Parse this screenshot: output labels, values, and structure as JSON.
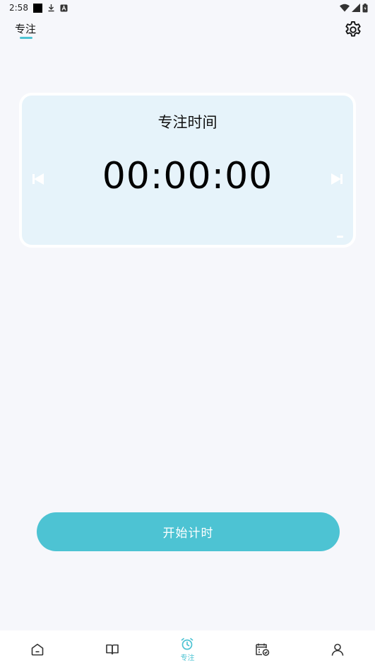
{
  "status_bar": {
    "time": "2:58",
    "left_icons": [
      "notification-square-icon",
      "download-icon",
      "a-box-icon"
    ],
    "right_icons": [
      "wifi-icon",
      "signal-icon",
      "battery-icon"
    ]
  },
  "header": {
    "tab_label": "专注",
    "settings_icon": "gear-icon"
  },
  "timer": {
    "title": "专注时间",
    "display": "00:00:00",
    "prev_icon": "arrow-left-icon",
    "next_icon": "arrow-right-icon"
  },
  "actions": {
    "start_label": "开始计时"
  },
  "bottom_nav": {
    "items": [
      {
        "icon": "home-icon",
        "label": ""
      },
      {
        "icon": "book-icon",
        "label": ""
      },
      {
        "icon": "alarm-clock-icon",
        "label": "专注",
        "active": true
      },
      {
        "icon": "calendar-check-icon",
        "label": ""
      },
      {
        "icon": "user-icon",
        "label": ""
      }
    ]
  },
  "colors": {
    "accent": "#4dc3d3",
    "card_bg": "#e6f3fa",
    "page_bg": "#f6f7fb"
  }
}
